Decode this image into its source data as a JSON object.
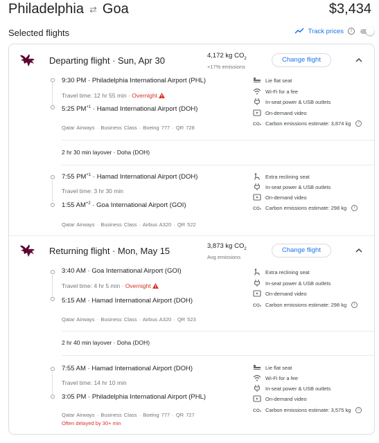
{
  "header": {
    "origin": "Philadelphia",
    "destination": "Goa",
    "price": "$3,434"
  },
  "selected": {
    "title": "Selected flights",
    "track_label": "Track prices"
  },
  "departing": {
    "title": "Departing flight",
    "date": "Sun, Apr 30",
    "emissions": "4,172 kg CO",
    "emissions_sub": "+17% emissions",
    "change_label": "Change flight",
    "leg1": {
      "dep_time": "9:30 PM",
      "dep_airport": "Philadelphia International Airport (PHL)",
      "travel_time": "Travel time: 12 hr 55 min",
      "overnight": "Overnight",
      "arr_time": "5:25 PM",
      "arr_offset": "+1",
      "arr_airport": "Hamad International Airport (DOH)",
      "meta": "Qatar Airways · Business Class · Boeing 777 · QR 728",
      "amenities": [
        "Lie flat seat",
        "Wi-Fi for a fee",
        "In-seat power & USB outlets",
        "On-demand video",
        "Carbon emissions estimate: 3,874 kg"
      ]
    },
    "layover": "2 hr 30 min layover · Doha (DOH)",
    "leg2": {
      "dep_time": "7:55 PM",
      "dep_offset": "+1",
      "dep_airport": "Hamad International Airport (DOH)",
      "travel_time": "Travel time: 3 hr 30 min",
      "arr_time": "1:55 AM",
      "arr_offset": "+2",
      "arr_airport": "Goa International Airport (GOI)",
      "meta": "Qatar Airways · Business Class · Airbus A320 · QR 522",
      "amenities": [
        "Extra reclining seat",
        "In-seat power & USB outlets",
        "On-demand video",
        "Carbon emissions estimate: 298 kg"
      ]
    }
  },
  "returning": {
    "title": "Returning flight",
    "date": "Mon, May 15",
    "emissions": "3,873 kg CO",
    "emissions_sub": "Avg emissions",
    "change_label": "Change flight",
    "leg1": {
      "dep_time": "3:40 AM",
      "dep_airport": "Goa International Airport (GOI)",
      "travel_time": "Travel time: 4 hr 5 min",
      "overnight": "Overnight",
      "arr_time": "5:15 AM",
      "arr_airport": "Hamad International Airport (DOH)",
      "meta": "Qatar Airways · Business Class · Airbus A320 · QR 523",
      "amenities": [
        "Extra reclining seat",
        "In-seat power & USB outlets",
        "On-demand video",
        "Carbon emissions estimate: 298 kg"
      ]
    },
    "layover": "2 hr 40 min layover · Doha (DOH)",
    "leg2": {
      "dep_time": "7:55 AM",
      "dep_airport": "Hamad International Airport (DOH)",
      "travel_time": "Travel time: 14 hr 10 min",
      "arr_time": "3:05 PM",
      "arr_airport": "Philadelphia International Airport (PHL)",
      "meta": "Qatar Airways · Business Class · Boeing 777 · QR 727",
      "delay": "Often delayed by 30+ min",
      "amenities": [
        "Lie flat seat",
        "Wi-Fi for a fee",
        "In-seat power & USB outlets",
        "On-demand video",
        "Carbon emissions estimate: 3,575 kg"
      ]
    }
  },
  "colors": {
    "accent": "#1a73e8",
    "warning": "#d93025",
    "qatar": "#5c0632"
  }
}
